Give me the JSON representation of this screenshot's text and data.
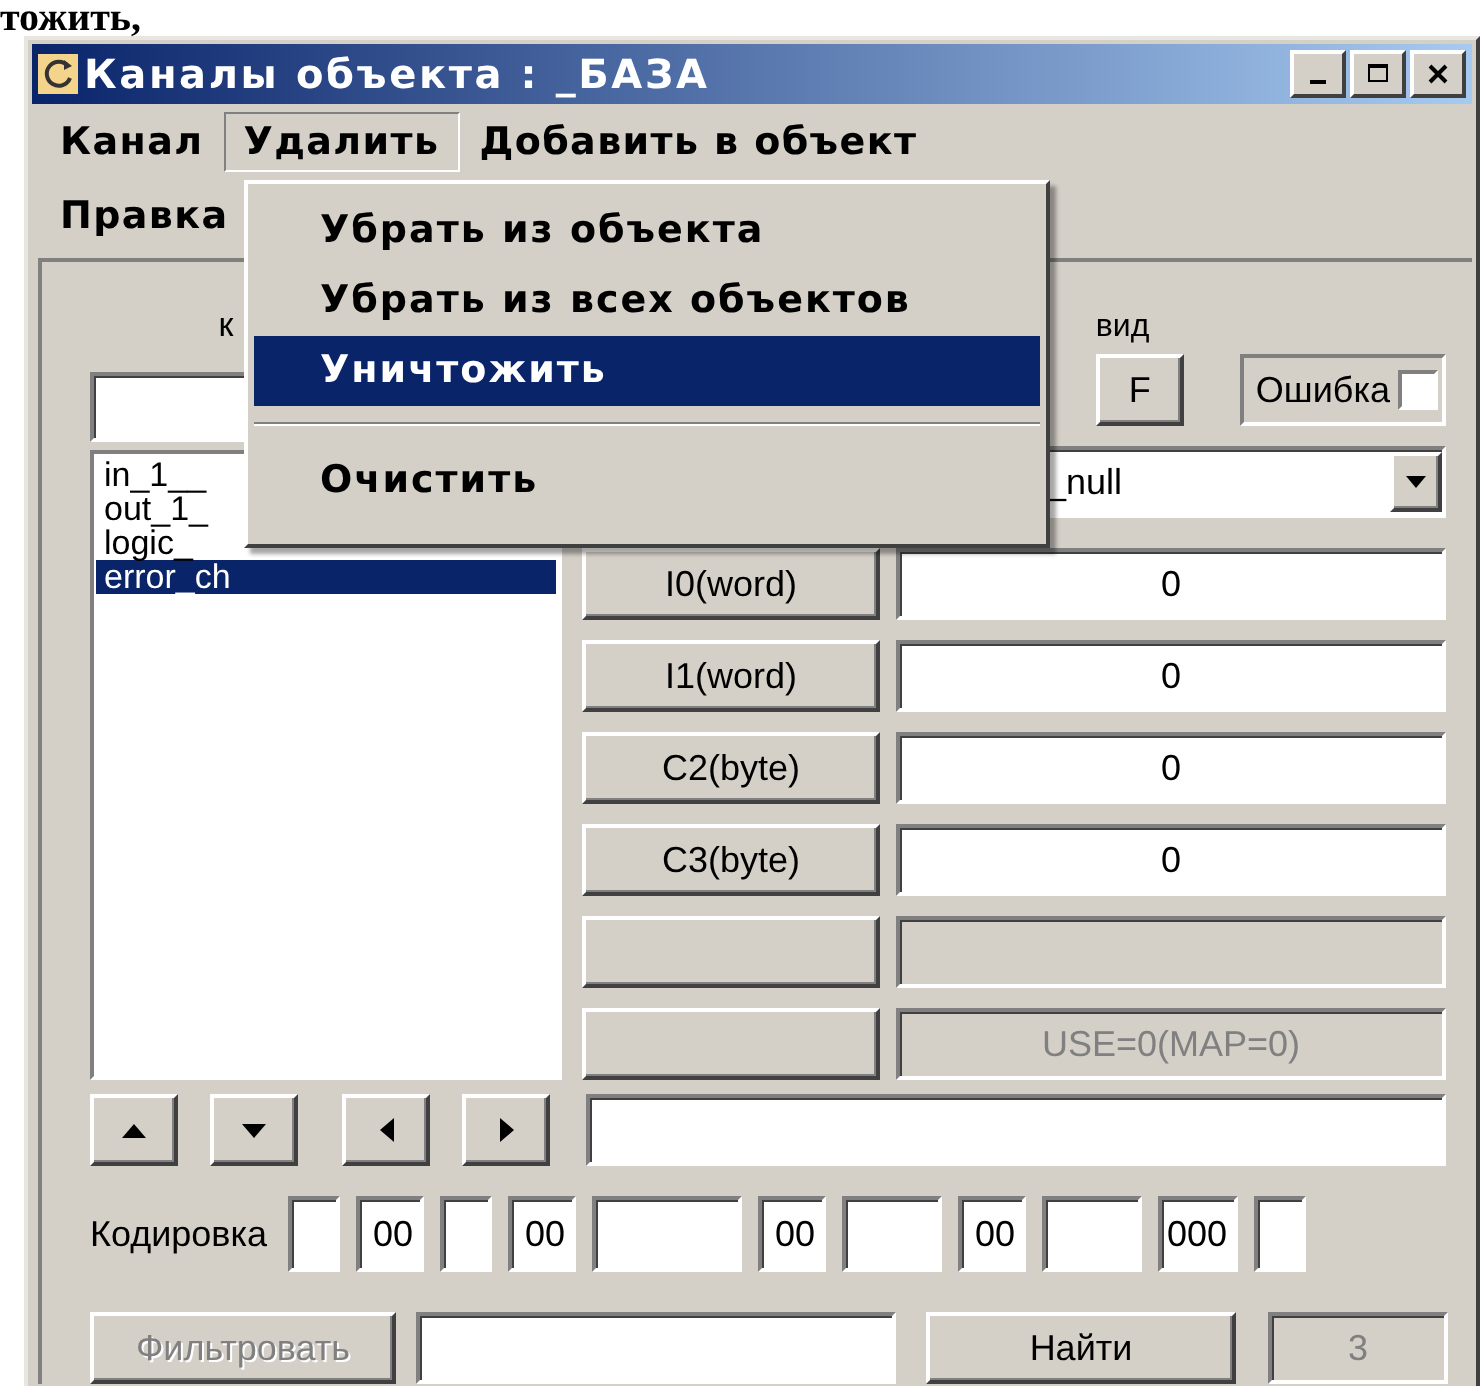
{
  "caption_fragment": "тожить,",
  "window": {
    "title": "Каналы объекта : _БАЗА"
  },
  "menu_bar": [
    {
      "label": "Канал",
      "selected": false
    },
    {
      "label": "Удалить",
      "selected": true
    },
    {
      "label": "Добавить в объект",
      "selected": false
    },
    {
      "label": "Правка",
      "selected": false
    }
  ],
  "dropdown_menu": [
    {
      "kind": "item",
      "label": "Убрать из объекта",
      "selected": false
    },
    {
      "kind": "item",
      "label": "Убрать из всех объектов",
      "selected": false
    },
    {
      "kind": "item",
      "label": "Уничтожить",
      "selected": true
    },
    {
      "kind": "separator"
    },
    {
      "kind": "item",
      "label": "Очистить",
      "selected": false
    }
  ],
  "name_label": "к",
  "channels": [
    {
      "name": "in_1__",
      "selected": false
    },
    {
      "name": "out_1_",
      "selected": false
    },
    {
      "name": "logic_",
      "selected": false
    },
    {
      "name": "error_ch",
      "selected": true
    }
  ],
  "view_label": "вид",
  "f_button": "F",
  "error_checkbox": {
    "label": "Ошибка",
    "checked": false
  },
  "type_combo": {
    "value": "_null"
  },
  "fields": [
    {
      "button": "I0(word)",
      "value": "0",
      "disabled": false
    },
    {
      "button": "I1(word)",
      "value": "0",
      "disabled": false
    },
    {
      "button": "C2(byte)",
      "value": "0",
      "disabled": false
    },
    {
      "button": "C3(byte)",
      "value": "0",
      "disabled": false
    },
    {
      "disabled": true
    },
    {
      "value": "USE=0(MAP=0)",
      "disabled": true
    }
  ],
  "encoding": {
    "label": "Кодировка",
    "boxes": [
      {
        "kind": "short"
      },
      {
        "kind": "code",
        "value": "00"
      },
      {
        "kind": "short"
      },
      {
        "kind": "code",
        "value": "00"
      },
      {
        "kind": "long"
      },
      {
        "kind": "code",
        "value": "00"
      },
      {
        "kind": "mid"
      },
      {
        "kind": "code",
        "value": "00"
      },
      {
        "kind": "mid"
      },
      {
        "kind": "code",
        "value": "000"
      },
      {
        "kind": "short"
      }
    ]
  },
  "filter_button": {
    "label": "Фильтровать",
    "disabled": true
  },
  "find_button": "Найти",
  "count_field": {
    "value": "3",
    "disabled": true
  }
}
